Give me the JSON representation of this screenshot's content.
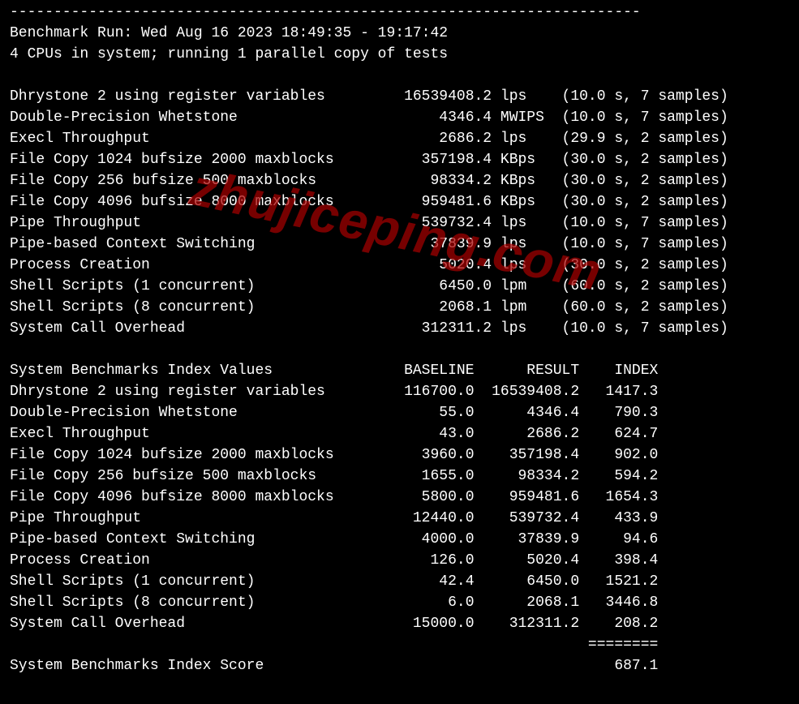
{
  "watermark": "zhujiceping.com",
  "separator_top": "------------------------------------------------------------------------",
  "run_header": "Benchmark Run: Wed Aug 16 2023 18:49:35 - 19:17:42",
  "cpu_line": "4 CPUs in system; running 1 parallel copy of tests",
  "results": [
    {
      "name": "Dhrystone 2 using register variables",
      "value": "16539408.2",
      "unit": "lps",
      "dur": "10.0",
      "samples": "7"
    },
    {
      "name": "Double-Precision Whetstone",
      "value": "4346.4",
      "unit": "MWIPS",
      "dur": "10.0",
      "samples": "7"
    },
    {
      "name": "Execl Throughput",
      "value": "2686.2",
      "unit": "lps",
      "dur": "29.9",
      "samples": "2"
    },
    {
      "name": "File Copy 1024 bufsize 2000 maxblocks",
      "value": "357198.4",
      "unit": "KBps",
      "dur": "30.0",
      "samples": "2"
    },
    {
      "name": "File Copy 256 bufsize 500 maxblocks",
      "value": "98334.2",
      "unit": "KBps",
      "dur": "30.0",
      "samples": "2"
    },
    {
      "name": "File Copy 4096 bufsize 8000 maxblocks",
      "value": "959481.6",
      "unit": "KBps",
      "dur": "30.0",
      "samples": "2"
    },
    {
      "name": "Pipe Throughput",
      "value": "539732.4",
      "unit": "lps",
      "dur": "10.0",
      "samples": "7"
    },
    {
      "name": "Pipe-based Context Switching",
      "value": "37839.9",
      "unit": "lps",
      "dur": "10.0",
      "samples": "7"
    },
    {
      "name": "Process Creation",
      "value": "5020.4",
      "unit": "lps",
      "dur": "30.0",
      "samples": "2"
    },
    {
      "name": "Shell Scripts (1 concurrent)",
      "value": "6450.0",
      "unit": "lpm",
      "dur": "60.0",
      "samples": "2"
    },
    {
      "name": "Shell Scripts (8 concurrent)",
      "value": "2068.1",
      "unit": "lpm",
      "dur": "60.0",
      "samples": "2"
    },
    {
      "name": "System Call Overhead",
      "value": "312311.2",
      "unit": "lps",
      "dur": "10.0",
      "samples": "7"
    }
  ],
  "index_header": {
    "title": "System Benchmarks Index Values",
    "c1": "BASELINE",
    "c2": "RESULT",
    "c3": "INDEX"
  },
  "index": [
    {
      "name": "Dhrystone 2 using register variables",
      "baseline": "116700.0",
      "result": "16539408.2",
      "index": "1417.3"
    },
    {
      "name": "Double-Precision Whetstone",
      "baseline": "55.0",
      "result": "4346.4",
      "index": "790.3"
    },
    {
      "name": "Execl Throughput",
      "baseline": "43.0",
      "result": "2686.2",
      "index": "624.7"
    },
    {
      "name": "File Copy 1024 bufsize 2000 maxblocks",
      "baseline": "3960.0",
      "result": "357198.4",
      "index": "902.0"
    },
    {
      "name": "File Copy 256 bufsize 500 maxblocks",
      "baseline": "1655.0",
      "result": "98334.2",
      "index": "594.2"
    },
    {
      "name": "File Copy 4096 bufsize 8000 maxblocks",
      "baseline": "5800.0",
      "result": "959481.6",
      "index": "1654.3"
    },
    {
      "name": "Pipe Throughput",
      "baseline": "12440.0",
      "result": "539732.4",
      "index": "433.9"
    },
    {
      "name": "Pipe-based Context Switching",
      "baseline": "4000.0",
      "result": "37839.9",
      "index": "94.6"
    },
    {
      "name": "Process Creation",
      "baseline": "126.0",
      "result": "5020.4",
      "index": "398.4"
    },
    {
      "name": "Shell Scripts (1 concurrent)",
      "baseline": "42.4",
      "result": "6450.0",
      "index": "1521.2"
    },
    {
      "name": "Shell Scripts (8 concurrent)",
      "baseline": "6.0",
      "result": "2068.1",
      "index": "3446.8"
    },
    {
      "name": "System Call Overhead",
      "baseline": "15000.0",
      "result": "312311.2",
      "index": "208.2"
    }
  ],
  "separator_eq": "========",
  "score_label": "System Benchmarks Index Score",
  "score_value": "687.1"
}
